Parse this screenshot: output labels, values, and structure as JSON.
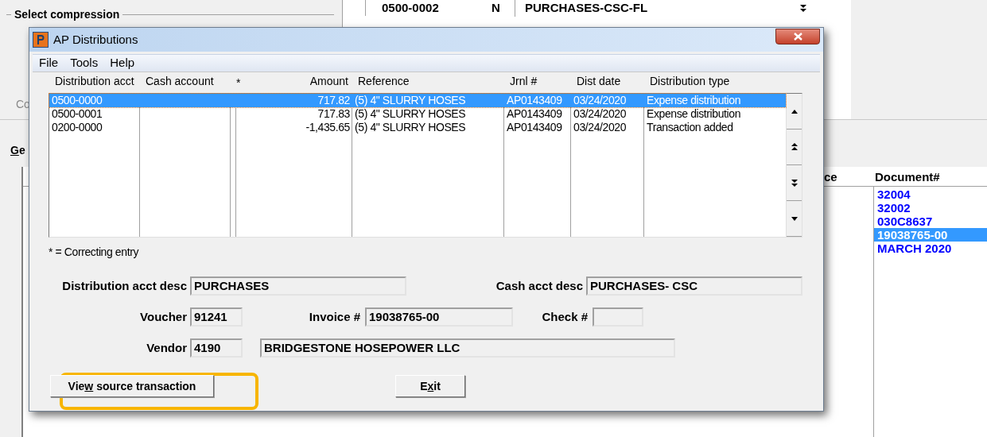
{
  "background_window": {
    "group_title": "Select compression",
    "label_fragment": "Co",
    "tab_fragment": {
      "mnemonic": "G",
      "rest": "e"
    },
    "top_row": {
      "account": "0500-0002",
      "flag": "N",
      "description": "PURCHASES-CSC-FL"
    },
    "documents": {
      "column_fragment": "ce",
      "header": "Document#",
      "rows": [
        {
          "value": "32004",
          "selected": false
        },
        {
          "value": "32002",
          "selected": false
        },
        {
          "value": "030C8637",
          "selected": false
        },
        {
          "value": "19038765-00",
          "selected": true
        },
        {
          "value": "MARCH 2020",
          "selected": false
        }
      ]
    }
  },
  "dialog": {
    "title": "AP Distributions",
    "menu": [
      "File",
      "Tools",
      "Help"
    ],
    "columns": [
      "Distribution acct",
      "Cash account",
      "*",
      "Amount",
      "Reference",
      "Jrnl #",
      "Dist date",
      "Distribution type"
    ],
    "rows": [
      {
        "selected": true,
        "cells": [
          "0500-0000",
          "",
          "",
          "717.82",
          "(5) 4\" SLURRY HOSES",
          "AP0143409",
          "03/24/2020",
          "Expense distribution"
        ]
      },
      {
        "selected": false,
        "cells": [
          "0500-0001",
          "",
          "",
          "717.83",
          "(5) 4\" SLURRY HOSES",
          "AP0143409",
          "03/24/2020",
          "Expense distribution"
        ]
      },
      {
        "selected": false,
        "cells": [
          "0200-0000",
          "",
          "",
          "-1,435.65",
          "(5) 4\" SLURRY HOSES",
          "AP0143409",
          "03/24/2020",
          "Transaction added"
        ]
      }
    ],
    "note": "* = Correcting entry",
    "fields": {
      "distribution_acct_desc": {
        "label": "Distribution acct desc",
        "value": "PURCHASES"
      },
      "cash_acct_desc": {
        "label": "Cash acct desc",
        "value": "PURCHASES- CSC"
      },
      "voucher": {
        "label": "Voucher",
        "value": "91241"
      },
      "invoice": {
        "label": "Invoice #",
        "value": "19038765-00"
      },
      "check": {
        "label": "Check #"
      },
      "vendor": {
        "label": "Vendor",
        "value": "4190",
        "name": "BRIDGESTONE HOSEPOWER LLC"
      }
    },
    "buttons": [
      {
        "before": "Vie",
        "mnemonic": "w",
        "after": " source transaction",
        "highlighted": true
      },
      {
        "before": "E",
        "mnemonic": "x",
        "after": "it",
        "highlighted": false
      }
    ]
  }
}
